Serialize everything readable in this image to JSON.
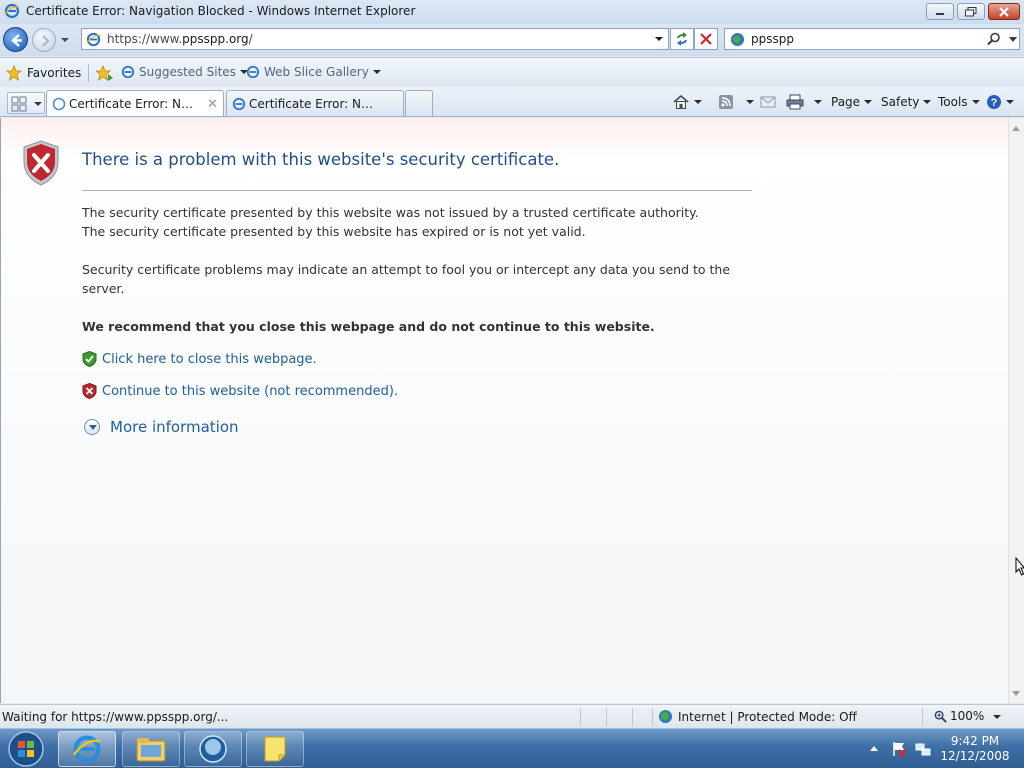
{
  "window": {
    "title": "Certificate Error: Navigation Blocked - Windows Internet Explorer"
  },
  "address_bar": {
    "url_prefix": "https://www.",
    "url_domain": "ppsspp.org",
    "url_suffix": "/"
  },
  "search": {
    "query": "ppsspp"
  },
  "favorites_bar": {
    "favorites_label": "Favorites",
    "links": [
      {
        "label": "Suggested Sites"
      },
      {
        "label": "Web Slice Gallery"
      }
    ]
  },
  "tabs": [
    {
      "label": "Certificate Error: Navig...",
      "active": true
    },
    {
      "label": "Certificate Error: Navigatio...",
      "active": false
    }
  ],
  "command_bar": {
    "page": "Page",
    "safety": "Safety",
    "tools": "Tools"
  },
  "content": {
    "heading": "There is a problem with this website's security certificate.",
    "line1": "The security certificate presented by this website was not issued by a trusted certificate authority.",
    "line2": "The security certificate presented by this website has expired or is not yet valid.",
    "para2": "Security certificate problems may indicate an attempt to fool you or intercept any data you send to the server.",
    "recommend": "We recommend that you close this webpage and do not continue to this website.",
    "close_link": "Click here to close this webpage.",
    "continue_link": "Continue to this website (not recommended).",
    "more_info": "More information"
  },
  "status_bar": {
    "status": "Waiting for https://www.ppsspp.org/...",
    "zone": "Internet | Protected Mode: Off",
    "zoom": "100%"
  },
  "taskbar": {
    "time": "9:42 PM",
    "date": "12/12/2008"
  },
  "colors": {
    "link": "#1f5f9c",
    "heading": "#1f4f8a",
    "danger_shield": "#c0262d",
    "safe_shield": "#3f9a2f",
    "taskbar": "#3d6fa6"
  }
}
